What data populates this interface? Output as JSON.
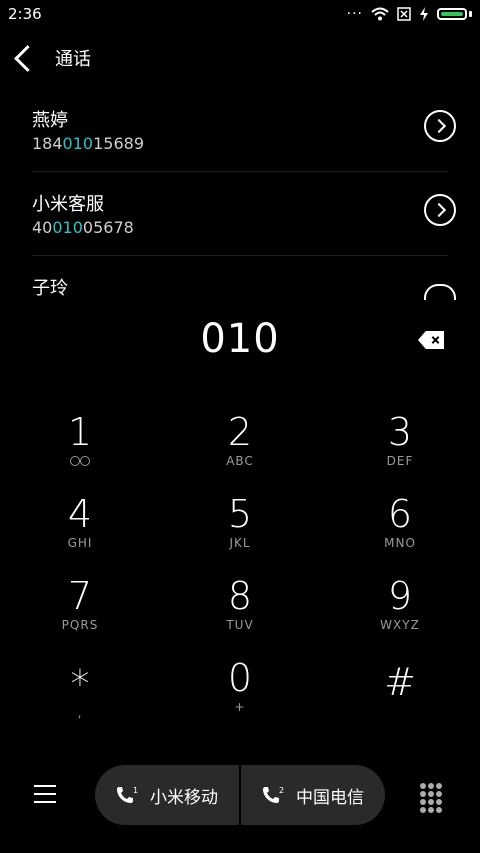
{
  "status": {
    "time": "2:36",
    "dots": "···",
    "wifi_icon": "wifi-icon",
    "sim_icon": "sim-off-icon",
    "charging_icon": "lightning-icon",
    "battery_color": "#34c759"
  },
  "header": {
    "title": "通话"
  },
  "contacts": [
    {
      "name": "燕婷",
      "num_pre": "184",
      "num_match": "010",
      "num_post": "15689"
    },
    {
      "name": "小米客服",
      "num_pre": "40",
      "num_match": "010",
      "num_post": "05678"
    },
    {
      "name": "子玲"
    }
  ],
  "dial": {
    "input": "010"
  },
  "keys": [
    {
      "digit": "1",
      "letters": ""
    },
    {
      "digit": "2",
      "letters": "ABC"
    },
    {
      "digit": "3",
      "letters": "DEF"
    },
    {
      "digit": "4",
      "letters": "GHI"
    },
    {
      "digit": "5",
      "letters": "JKL"
    },
    {
      "digit": "6",
      "letters": "MNO"
    },
    {
      "digit": "7",
      "letters": "PQRS"
    },
    {
      "digit": "8",
      "letters": "TUV"
    },
    {
      "digit": "9",
      "letters": "WXYZ"
    },
    {
      "digit": "*",
      "letters": ","
    },
    {
      "digit": "0",
      "letters": "+"
    },
    {
      "digit": "#",
      "letters": ""
    }
  ],
  "sim": [
    {
      "label": "小米移动",
      "slot": "1"
    },
    {
      "label": "中国电信",
      "slot": "2"
    }
  ],
  "accent": "#2bc4c9"
}
